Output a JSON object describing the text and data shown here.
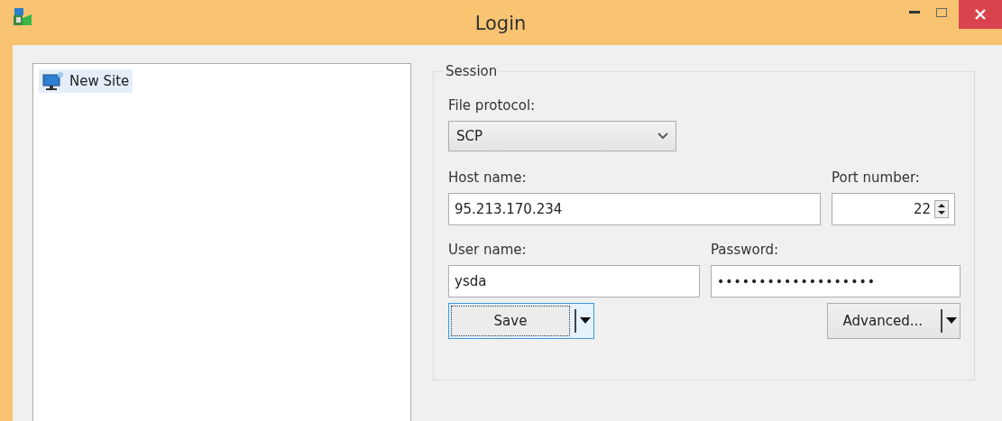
{
  "window": {
    "title": "Login"
  },
  "site_tree": {
    "items": [
      {
        "label": "New Site",
        "selected": true
      }
    ]
  },
  "session": {
    "title": "Session",
    "file_protocol": {
      "label": "File protocol:",
      "value": "SCP"
    },
    "host_name": {
      "label": "Host name:",
      "value": "95.213.170.234"
    },
    "port_number": {
      "label": "Port number:",
      "value": "22"
    },
    "user_name": {
      "label": "User name:",
      "value": "ysda"
    },
    "password": {
      "label": "Password:",
      "value": "•••••••••••••••••••"
    },
    "buttons": [
      {
        "label": "Save",
        "focused": true
      },
      {
        "label": "Advanced...",
        "focused": false
      }
    ]
  }
}
